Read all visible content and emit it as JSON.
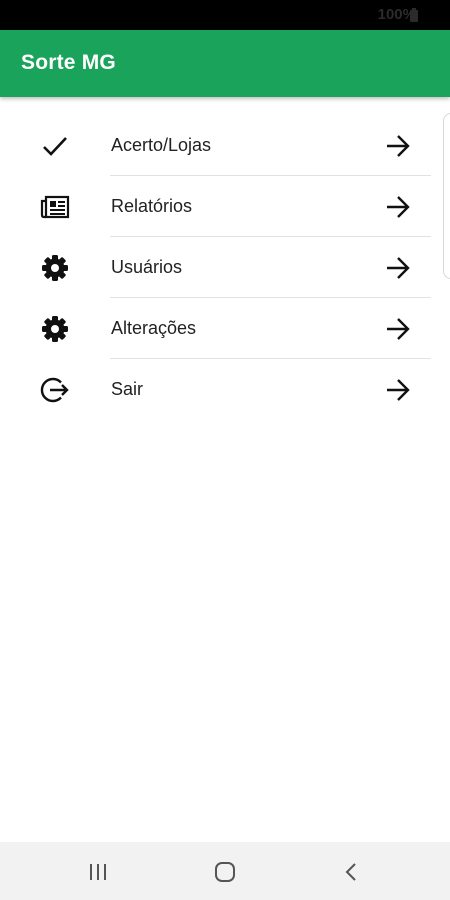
{
  "status_bar": {
    "battery_text": "100%"
  },
  "app_bar": {
    "title": "Sorte MG",
    "color": "#1aa35a"
  },
  "menu": {
    "items": [
      {
        "label": "Acerto/Lojas",
        "icon": "check-icon"
      },
      {
        "label": "Relatórios",
        "icon": "newspaper-icon"
      },
      {
        "label": "Usuários",
        "icon": "gear-icon"
      },
      {
        "label": "Alterações",
        "icon": "gear-icon"
      },
      {
        "label": "Sair",
        "icon": "logout-icon"
      }
    ],
    "trailing_icon": "arrow-right-icon"
  },
  "nav_bar": {
    "buttons": [
      "recent-apps-icon",
      "home-icon",
      "back-icon"
    ]
  }
}
